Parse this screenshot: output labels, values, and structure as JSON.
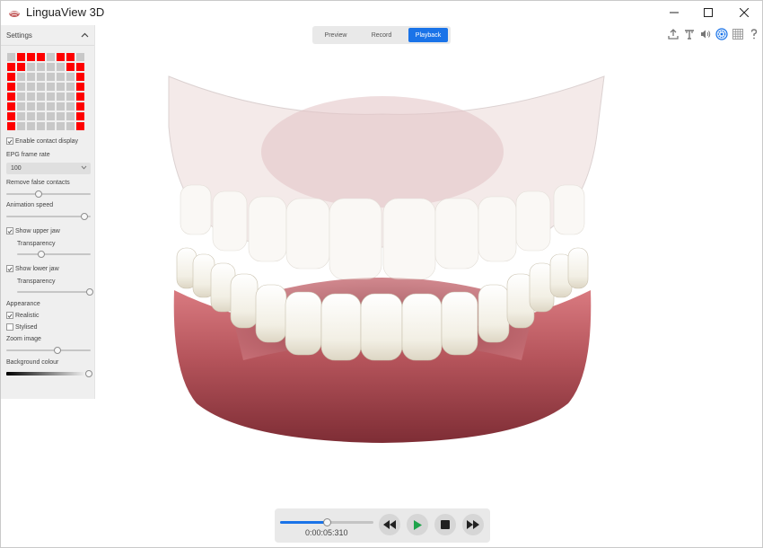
{
  "window": {
    "title": "LinguaView 3D"
  },
  "settings": {
    "header": "Settings",
    "epg_grid": {
      "cols": 8,
      "rows": 8,
      "colors": {
        "contact": "#ff0000",
        "no_contact": "#c8c8c8"
      },
      "contacts": [
        [
          false,
          true,
          true,
          true,
          false,
          true,
          true,
          false
        ],
        [
          true,
          true,
          false,
          false,
          false,
          false,
          true,
          true
        ],
        [
          true,
          false,
          false,
          false,
          false,
          false,
          false,
          true
        ],
        [
          true,
          false,
          false,
          false,
          false,
          false,
          false,
          true
        ],
        [
          true,
          false,
          false,
          false,
          false,
          false,
          false,
          true
        ],
        [
          true,
          false,
          false,
          false,
          false,
          false,
          false,
          true
        ],
        [
          true,
          false,
          false,
          false,
          false,
          false,
          false,
          true
        ],
        [
          true,
          false,
          false,
          false,
          false,
          false,
          false,
          true
        ]
      ]
    },
    "enable_contact_display": {
      "label": "Enable contact display",
      "checked": true
    },
    "epg_frame_rate": {
      "label": "EPG frame rate",
      "value": "100"
    },
    "remove_false_contacts": {
      "label": "Remove false contacts",
      "value": 0.38
    },
    "animation_speed": {
      "label": "Animation speed",
      "value": 0.93
    },
    "show_upper_jaw": {
      "label": "Show upper jaw",
      "checked": true
    },
    "upper_transparency": {
      "label": "Transparency",
      "value": 0.33
    },
    "show_lower_jaw": {
      "label": "Show lower jaw",
      "checked": true
    },
    "lower_transparency": {
      "label": "Transparency",
      "value": 0.99
    },
    "appearance": {
      "label": "Appearance",
      "realistic": {
        "label": "Realistic",
        "checked": true
      },
      "stylised": {
        "label": "Stylised",
        "checked": false
      }
    },
    "zoom_image": {
      "label": "Zoom image",
      "value": 0.61
    },
    "background_colour": {
      "label": "Background colour",
      "value": 0.98
    }
  },
  "modes": {
    "items": [
      "Preview",
      "Record",
      "Playback"
    ],
    "active": "Playback",
    "accent": "#1a73e8"
  },
  "toolbar_icons": [
    "export-icon",
    "text-icon",
    "speaker-icon",
    "settings-icon",
    "grid-icon",
    "help-icon"
  ],
  "playback": {
    "time": "0:00:05:310",
    "progress": 0.5
  }
}
